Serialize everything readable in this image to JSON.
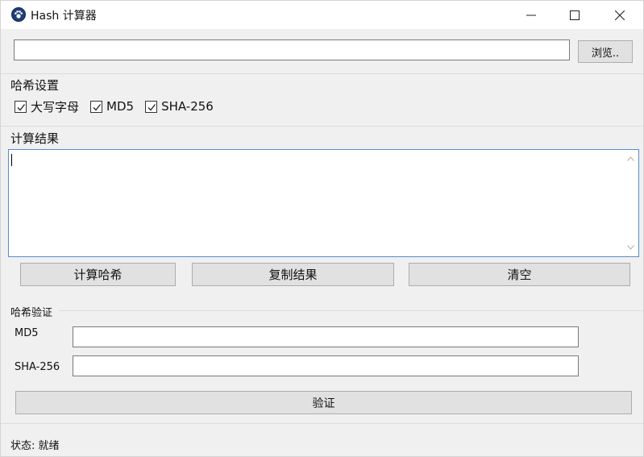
{
  "window": {
    "title": "Hash 计算器",
    "icon": "app-paw-icon"
  },
  "file": {
    "path_value": "",
    "browse_label": "浏览.."
  },
  "hash_settings": {
    "label": "哈希设置",
    "options": [
      {
        "label": "大写字母",
        "checked": true
      },
      {
        "label": "MD5",
        "checked": true
      },
      {
        "label": "SHA-256",
        "checked": true
      }
    ]
  },
  "result": {
    "label": "计算结果",
    "value": ""
  },
  "actions": {
    "compute_label": "计算哈希",
    "copy_label": "复制结果",
    "clear_label": "清空"
  },
  "verify": {
    "label": "哈希验证",
    "md5_label": "MD5",
    "md5_value": "",
    "sha256_label": "SHA-256",
    "sha256_value": "",
    "button_label": "验证"
  },
  "status": {
    "text": "状态: 就绪"
  }
}
